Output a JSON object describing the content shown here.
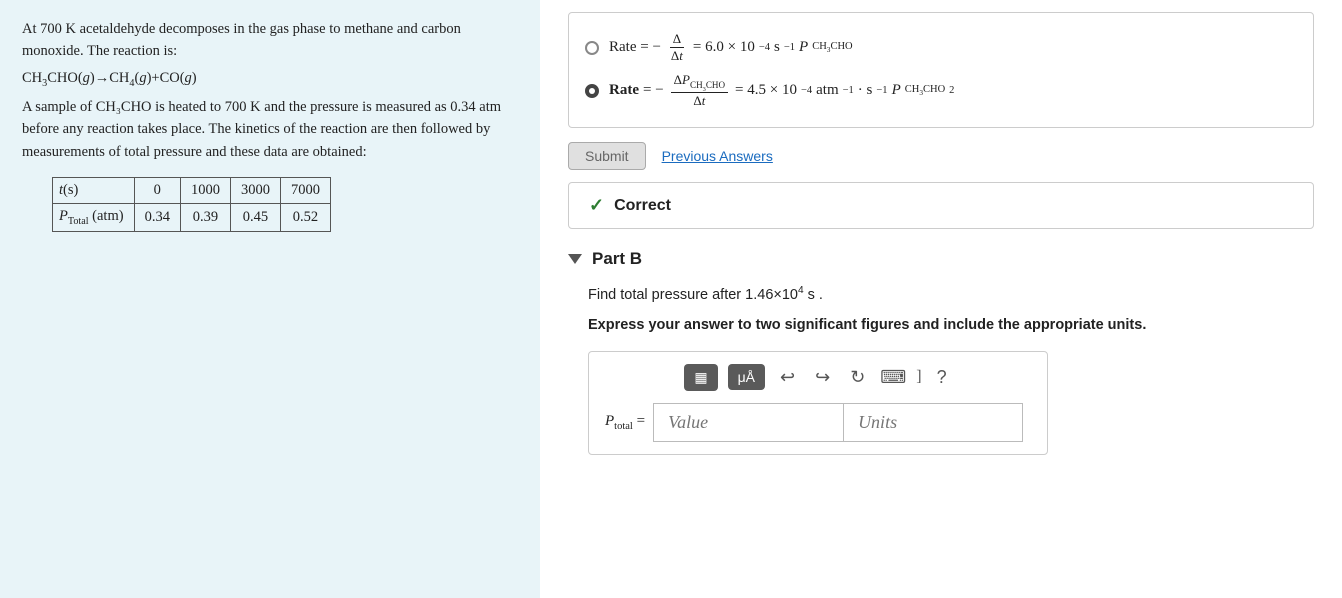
{
  "left": {
    "intro": "At 700 K acetaldehyde decomposes in the gas phase to methane and carbon monoxide. The reaction is:",
    "reaction_arrow": "CH₃CHO(g)→CH₄(g)+CO(g)",
    "description": "A sample of CH₃CHO is heated to 700 K and the pressure is measured as 0.34 atm before any reaction takes place. The kinetics of the reaction are then followed by measurements of total pressure and these data are obtained:",
    "table": {
      "headers": [
        "t(s)",
        "0",
        "1000",
        "3000",
        "7000"
      ],
      "row2_label": "P_Total (atm)",
      "row2_values": [
        "0.34",
        "0.39",
        "0.45",
        "0.52"
      ]
    }
  },
  "right": {
    "rate_option1": {
      "selected": false,
      "math_display": "Rate = −(Δ/Δt) = 6.0 × 10 ⁻⁴ s⁻¹ P_CH₃CHO"
    },
    "rate_option2": {
      "selected": true,
      "math_display": "Rate = −(ΔP_CH₃CHO/Δt) = 4.5 × 10⁻⁴ atm⁻¹·s⁻¹ P_CH₃CHO²"
    },
    "submit_label": "Submit",
    "prev_answers_label": "Previous Answers",
    "correct_label": "Correct",
    "part_b": {
      "label": "Part B",
      "find_text": "Find total pressure after 1.46×10⁴ s .",
      "express_text": "Express your answer to two significant figures and include the appropriate units.",
      "value_placeholder": "Value",
      "units_placeholder": "Units"
    },
    "toolbar": {
      "matrix_label": "⊟",
      "mu_label": "μÅ",
      "undo_label": "↩",
      "redo_label": "↪",
      "refresh_label": "↻",
      "keyboard_label": "⌨",
      "help_label": "?"
    }
  }
}
